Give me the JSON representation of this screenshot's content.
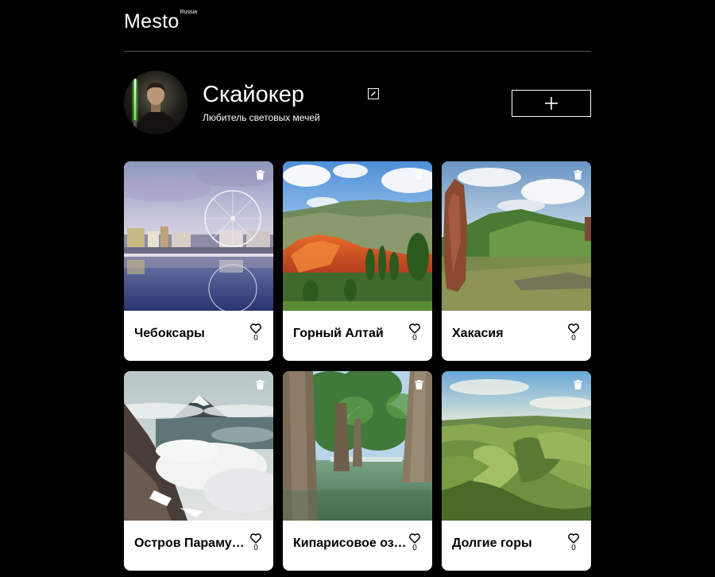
{
  "header": {
    "logo_main": "Mesto",
    "logo_sup": "Russia"
  },
  "profile": {
    "name": "Скайокер",
    "about": "Любитель световых мечей",
    "edit_icon": "pencil-icon",
    "add_icon": "plus-icon"
  },
  "cards": [
    {
      "title": "Чебоксары",
      "likes": "0"
    },
    {
      "title": "Горный Алтай",
      "likes": "0"
    },
    {
      "title": "Хакасия",
      "likes": "0"
    },
    {
      "title": "Остров Парамушир",
      "likes": "0"
    },
    {
      "title": "Кипарисовое озеро",
      "likes": "0"
    },
    {
      "title": "Долгие горы",
      "likes": "0"
    }
  ],
  "colors": {
    "background": "#000000",
    "card": "#ffffff",
    "divider": "#545454"
  }
}
